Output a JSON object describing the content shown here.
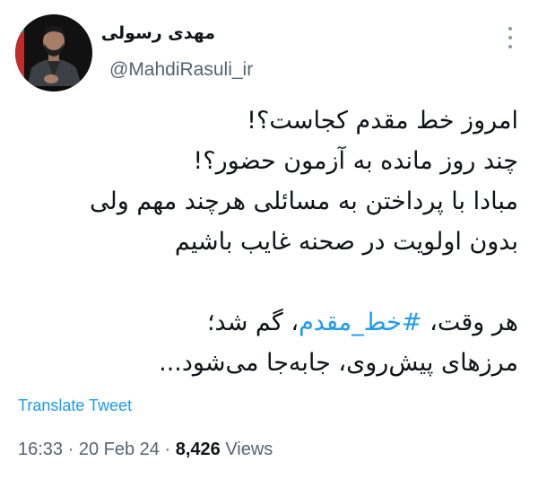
{
  "author": {
    "display_name": "مهدی رسولی",
    "handle": "@MahdiRasuli_ir"
  },
  "tweet": {
    "line1": "امروز خط مقدم کجاست؟!",
    "line2": "چند روز مانده به آزمون حضور؟!",
    "line3": "مبادا با پرداختن به مسائلی هرچند مهم ولی",
    "line4": "بدون اولویت در صحنه غایب باشیم",
    "line5_prefix": "هر وقت، ",
    "hashtag": "#خط_مقدم",
    "line5_suffix": "، گم شد؛",
    "line6": "مرزهای پیش‌روی، جابه‌جا می‌شود..."
  },
  "translate_label": "Translate Tweet",
  "meta": {
    "time": "16:33",
    "separator1": " · ",
    "date": "20 Feb 24",
    "separator2": " · ",
    "views_count": "8,426",
    "views_label": " Views"
  },
  "icons": {
    "more": "more-options-icon"
  },
  "colors": {
    "link": "#1d9bf0",
    "secondary_text": "#536471",
    "primary_text": "#0f1419"
  }
}
